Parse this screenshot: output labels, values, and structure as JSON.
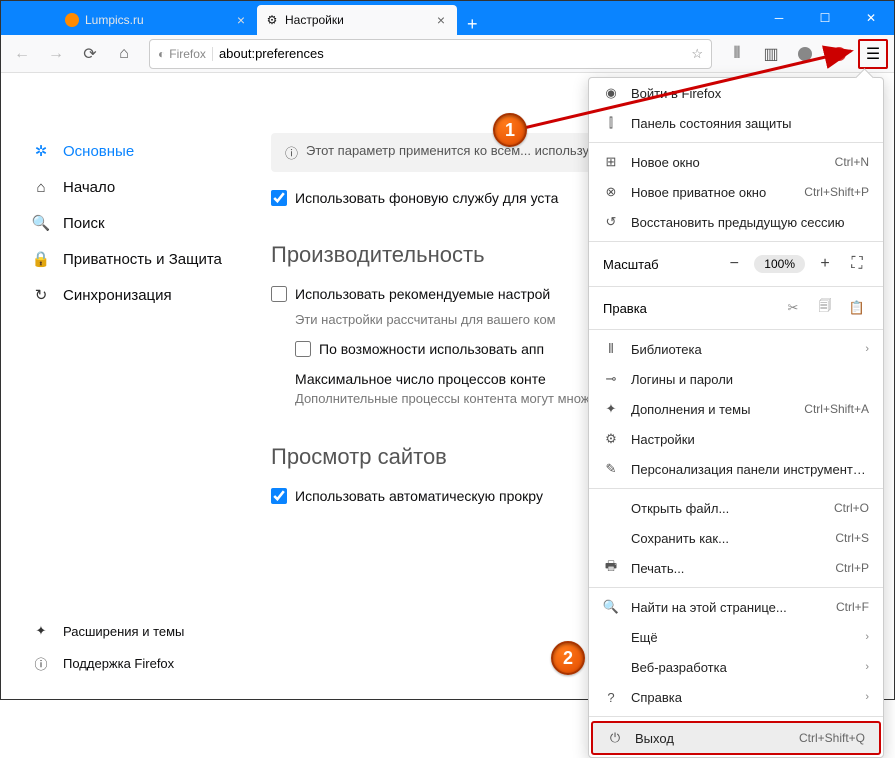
{
  "tabs": [
    {
      "title": "Lumpics.ru"
    },
    {
      "title": "Настройки"
    }
  ],
  "url": {
    "prefix": "Firefox",
    "value": "about:preferences"
  },
  "sidebar": {
    "items": [
      {
        "label": "Основные"
      },
      {
        "label": "Начало"
      },
      {
        "label": "Поиск"
      },
      {
        "label": "Приватность и Защита"
      },
      {
        "label": "Синхронизация"
      }
    ],
    "bottom": [
      {
        "label": "Расширения и темы"
      },
      {
        "label": "Поддержка Firefox"
      }
    ]
  },
  "main": {
    "info_line": "Этот параметр применится ко всем... использующим эту установку Firefox.",
    "check_bg": "Использовать фоновую службу для уста",
    "section_perf": "Производительность",
    "check_rec": "Использовать рекомендуемые настрой",
    "desc_rec": "Эти настройки рассчитаны для вашего ком",
    "check_hw": "По возможности использовать апп",
    "proc_label": "Максимальное число процессов конте",
    "proc_desc": "Дополнительные процессы контента могут множеством вкладок, но также потребуют по",
    "section_view": "Просмотр сайтов",
    "check_scroll": "Использовать автоматическую прокру"
  },
  "menu": {
    "signin": "Войти в Firefox",
    "shield": "Панель состояния защиты",
    "newwin": {
      "label": "Новое окно",
      "shortcut": "Ctrl+N"
    },
    "newpriv": {
      "label": "Новое приватное окно",
      "shortcut": "Ctrl+Shift+P"
    },
    "restore": "Восстановить предыдущую сессию",
    "zoom_label": "Масштаб",
    "zoom_pct": "100%",
    "edit_label": "Правка",
    "library": "Библиотека",
    "logins": "Логины и пароли",
    "addons": {
      "label": "Дополнения и темы",
      "shortcut": "Ctrl+Shift+A"
    },
    "settings": "Настройки",
    "customize": "Персонализация панели инструментов...",
    "open": {
      "label": "Открыть файл...",
      "shortcut": "Ctrl+O"
    },
    "save": {
      "label": "Сохранить как...",
      "shortcut": "Ctrl+S"
    },
    "print": {
      "label": "Печать...",
      "shortcut": "Ctrl+P"
    },
    "find": {
      "label": "Найти на этой странице...",
      "shortcut": "Ctrl+F"
    },
    "more": "Ещё",
    "webdev": "Веб-разработка",
    "help": "Справка",
    "exit": {
      "label": "Выход",
      "shortcut": "Ctrl+Shift+Q"
    }
  },
  "callouts": {
    "c1": "1",
    "c2": "2"
  }
}
